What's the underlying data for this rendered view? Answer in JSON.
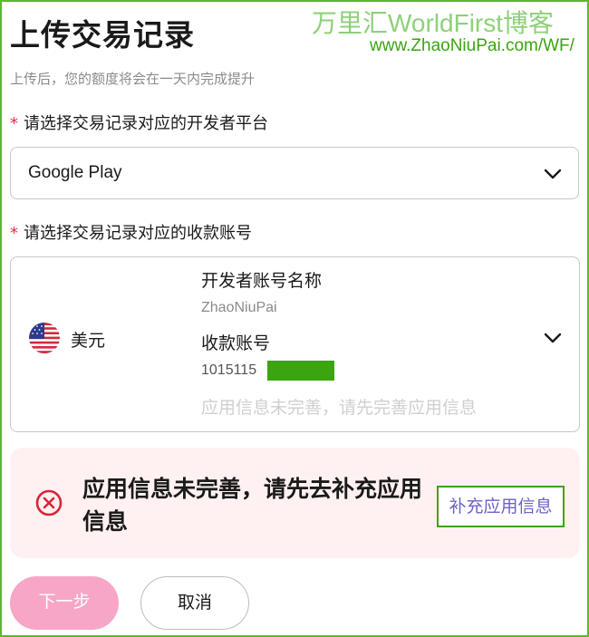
{
  "page": {
    "title": "上传交易记录",
    "subtitle": "上传后，您的额度将会在一天内完成提升"
  },
  "watermark": {
    "title": "万里汇WorldFirst博客",
    "url": "www.ZhaoNiuPai.com/WF/"
  },
  "platform_field": {
    "required_mark": "*",
    "label": "请选择交易记录对应的开发者平台",
    "value": "Google Play"
  },
  "account_field": {
    "required_mark": "*",
    "label": "请选择交易记录对应的收款账号",
    "currency": "美元",
    "developer_name_label": "开发者账号名称",
    "developer_name": "ZhaoNiuPai",
    "account_number_label": "收款账号",
    "account_number": "1015115",
    "app_info_notice": "应用信息未完善，请先完善应用信息"
  },
  "alert": {
    "message": "应用信息未完善，请先去补充应用信息",
    "action_label": "补充应用信息"
  },
  "buttons": {
    "next": "下一步",
    "cancel": "取消"
  },
  "colors": {
    "primary_disabled": "#f7a6c8",
    "required": "#e0304a",
    "alert_bg": "#fff1f1",
    "error": "#d9243a",
    "link": "#6b63c7",
    "watermark_green": "#3aa510"
  }
}
